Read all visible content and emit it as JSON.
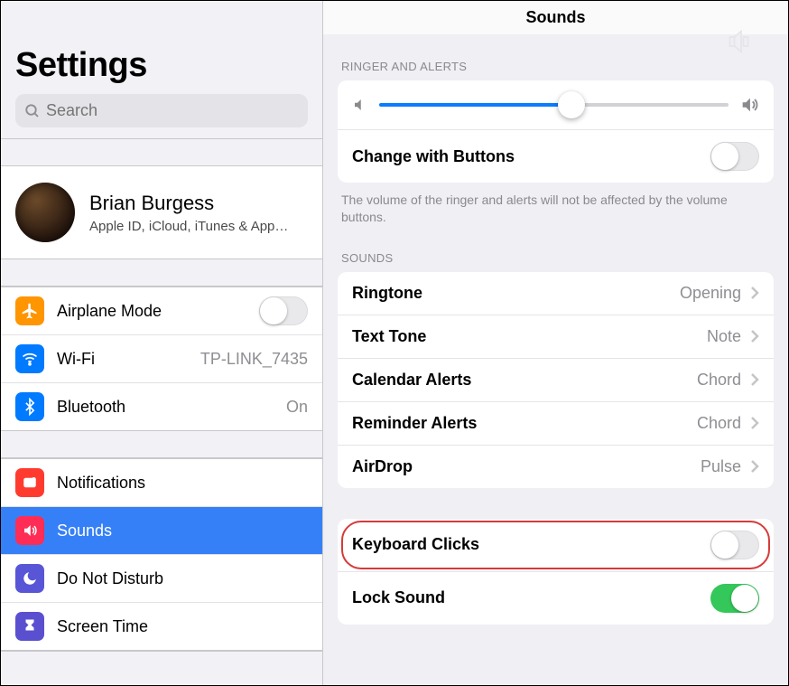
{
  "sidebar": {
    "title": "Settings",
    "search_placeholder": "Search",
    "profile": {
      "name": "Brian Burgess",
      "sub": "Apple ID, iCloud, iTunes & App…"
    },
    "items_conn": [
      {
        "label": "Airplane Mode"
      },
      {
        "label": "Wi-Fi",
        "value": "TP-LINK_7435"
      },
      {
        "label": "Bluetooth",
        "value": "On"
      }
    ],
    "items_sys": [
      {
        "label": "Notifications"
      },
      {
        "label": "Sounds"
      },
      {
        "label": "Do Not Disturb"
      },
      {
        "label": "Screen Time"
      }
    ]
  },
  "detail": {
    "title": "Sounds",
    "section_ringer": "RINGER AND ALERTS",
    "change_label": "Change with Buttons",
    "ringer_note": "The volume of the ringer and alerts will not be affected by the volume buttons.",
    "section_sounds": "SOUNDS",
    "sound_rows": [
      {
        "label": "Ringtone",
        "value": "Opening"
      },
      {
        "label": "Text Tone",
        "value": "Note"
      },
      {
        "label": "Calendar Alerts",
        "value": "Chord"
      },
      {
        "label": "Reminder Alerts",
        "value": "Chord"
      },
      {
        "label": "AirDrop",
        "value": "Pulse"
      }
    ],
    "kb_clicks_label": "Keyboard Clicks",
    "lock_sound_label": "Lock Sound"
  }
}
